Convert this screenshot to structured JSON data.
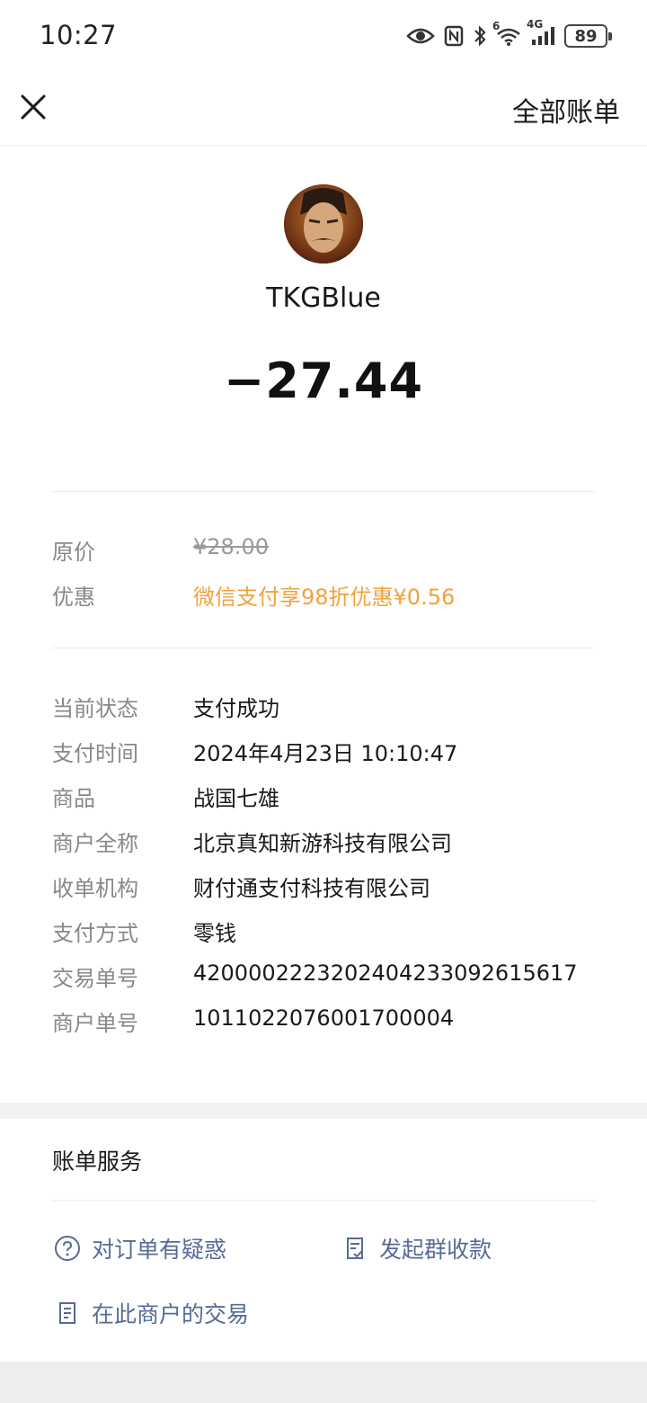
{
  "status_bar": {
    "time": "10:27",
    "network_label": "4G",
    "wifi_badge": "6",
    "battery": "89",
    "icons": [
      "eye-icon",
      "nfc-icon",
      "bluetooth-icon",
      "wifi-icon",
      "signal-icon",
      "battery-icon"
    ]
  },
  "nav": {
    "close_icon": "close-icon",
    "all_bills": "全部账单"
  },
  "merchant": {
    "name": "TKGBlue",
    "amount": "−27.44"
  },
  "pricing": {
    "original_label": "原价",
    "original_value": "¥28.00",
    "discount_label": "优惠",
    "discount_value": "微信支付享98折优惠¥0.56"
  },
  "details": [
    {
      "label": "当前状态",
      "value": "支付成功"
    },
    {
      "label": "支付时间",
      "value": "2024年4月23日 10:10:47"
    },
    {
      "label": "商品",
      "value": "战国七雄"
    },
    {
      "label": "商户全称",
      "value": "北京真知新游科技有限公司"
    },
    {
      "label": "收单机构",
      "value": "财付通支付科技有限公司"
    },
    {
      "label": "支付方式",
      "value": "零钱"
    },
    {
      "label": "交易单号",
      "value": "4200002223202404233092615617"
    },
    {
      "label": "商户单号",
      "value": "1011022076001700004"
    }
  ],
  "services": {
    "title": "账单服务",
    "items": [
      {
        "label": "对订单有疑惑",
        "icon": "question-circle-icon"
      },
      {
        "label": "发起群收款",
        "icon": "checklist-icon"
      },
      {
        "label": "在此商户的交易",
        "icon": "document-icon"
      }
    ]
  },
  "colors": {
    "discount": "#f2a23b",
    "link": "#576b95",
    "label": "#888888"
  }
}
